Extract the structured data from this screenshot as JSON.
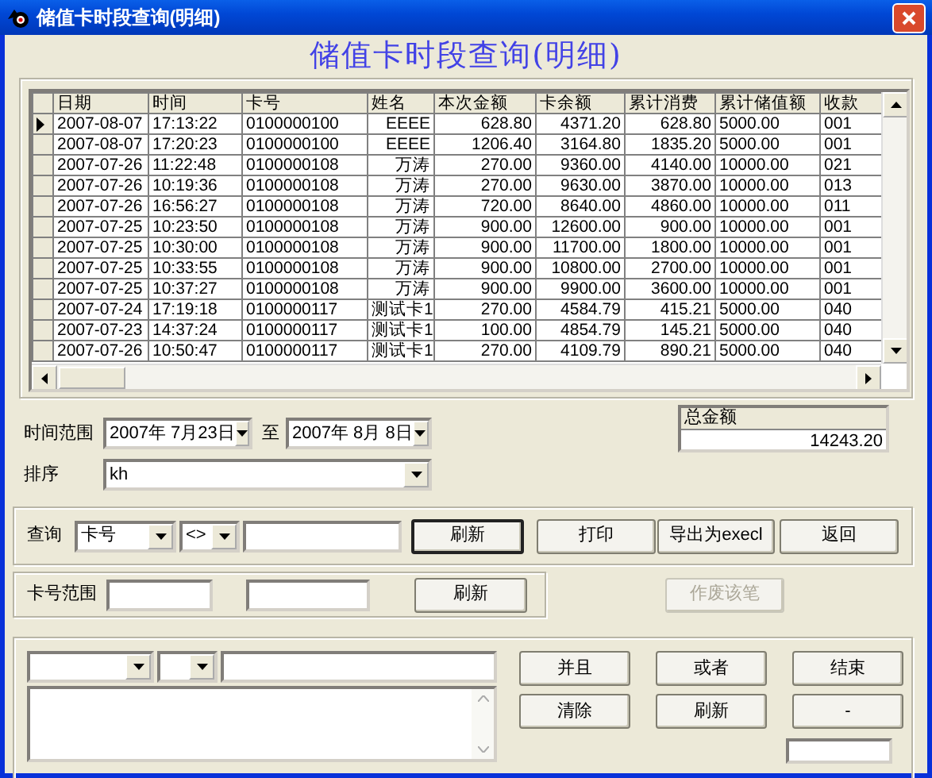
{
  "window": {
    "title": "储值卡时段查询(明细)"
  },
  "heading": "储值卡时段查询(明细)",
  "table": {
    "columns": [
      "日期",
      "时间",
      "卡号",
      "姓名",
      "本次金额",
      "卡余额",
      "累计消费",
      "累计储值额",
      "收款"
    ],
    "rows": [
      {
        "selected": true,
        "cells": [
          "2007-08-07",
          "17:13:22",
          "0100000100",
          "EEEE",
          "628.80",
          "4371.20",
          "628.80",
          "5000.00",
          "001"
        ]
      },
      {
        "selected": false,
        "cells": [
          "2007-08-07",
          "17:20:23",
          "0100000100",
          "EEEE",
          "1206.40",
          "3164.80",
          "1835.20",
          "5000.00",
          "001"
        ]
      },
      {
        "selected": false,
        "cells": [
          "2007-07-26",
          "11:22:48",
          "0100000108",
          "万涛",
          "270.00",
          "9360.00",
          "4140.00",
          "10000.00",
          "021"
        ]
      },
      {
        "selected": false,
        "cells": [
          "2007-07-26",
          "10:19:36",
          "0100000108",
          "万涛",
          "270.00",
          "9630.00",
          "3870.00",
          "10000.00",
          "013"
        ]
      },
      {
        "selected": false,
        "cells": [
          "2007-07-26",
          "16:56:27",
          "0100000108",
          "万涛",
          "720.00",
          "8640.00",
          "4860.00",
          "10000.00",
          "011"
        ]
      },
      {
        "selected": false,
        "cells": [
          "2007-07-25",
          "10:23:50",
          "0100000108",
          "万涛",
          "900.00",
          "12600.00",
          "900.00",
          "10000.00",
          "001"
        ]
      },
      {
        "selected": false,
        "cells": [
          "2007-07-25",
          "10:30:00",
          "0100000108",
          "万涛",
          "900.00",
          "11700.00",
          "1800.00",
          "10000.00",
          "001"
        ]
      },
      {
        "selected": false,
        "cells": [
          "2007-07-25",
          "10:33:55",
          "0100000108",
          "万涛",
          "900.00",
          "10800.00",
          "2700.00",
          "10000.00",
          "001"
        ]
      },
      {
        "selected": false,
        "cells": [
          "2007-07-25",
          "10:37:27",
          "0100000108",
          "万涛",
          "900.00",
          "9900.00",
          "3600.00",
          "10000.00",
          "001"
        ]
      },
      {
        "selected": false,
        "cells": [
          "2007-07-24",
          "17:19:18",
          "0100000117",
          "测试卡1",
          "270.00",
          "4584.79",
          "415.21",
          "5000.00",
          "040"
        ]
      },
      {
        "selected": false,
        "cells": [
          "2007-07-23",
          "14:37:24",
          "0100000117",
          "测试卡1",
          "100.00",
          "4854.79",
          "145.21",
          "5000.00",
          "040"
        ]
      },
      {
        "selected": false,
        "cells": [
          "2007-07-26",
          "10:50:47",
          "0100000117",
          "测试卡1",
          "270.00",
          "4109.79",
          "890.21",
          "5000.00",
          "040"
        ]
      }
    ]
  },
  "time_range": {
    "label": "时间范围",
    "from": "2007年 7月23日",
    "separator": "至",
    "to": "2007年 8月 8日"
  },
  "total": {
    "label": "总金额",
    "value": "14243.20"
  },
  "sort": {
    "label": "排序",
    "value": "kh"
  },
  "query": {
    "label": "查询",
    "field": "卡号",
    "operator": "<>",
    "buttons": [
      {
        "label": "刷新",
        "focused": true
      },
      {
        "label": "打印",
        "focused": false
      },
      {
        "label": "导出为execl",
        "focused": false
      },
      {
        "label": "返回",
        "focused": false
      }
    ]
  },
  "card_range": {
    "label": "卡号范围",
    "button": "刷新"
  },
  "void_button": {
    "label": "作废该笔",
    "disabled": true
  },
  "condition_buttons": [
    "并且",
    "或者",
    "结束",
    "清除",
    "刷新",
    "-"
  ]
}
